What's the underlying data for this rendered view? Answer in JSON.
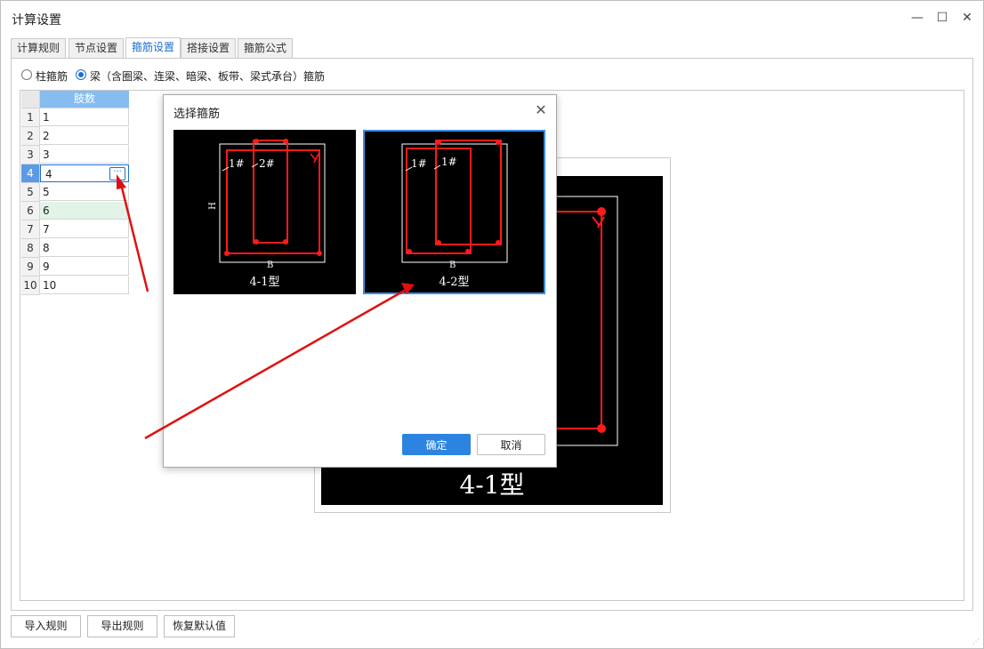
{
  "window": {
    "title": "计算设置"
  },
  "tabs": [
    {
      "label": "计算规则"
    },
    {
      "label": "节点设置"
    },
    {
      "label": "箍筋设置"
    },
    {
      "label": "搭接设置"
    },
    {
      "label": "箍筋公式"
    }
  ],
  "radio": {
    "option1": "柱箍筋",
    "option2": "梁（含圈梁、连梁、暗梁、板带、梁式承台）箍筋"
  },
  "grid": {
    "header": "肢数",
    "rows": [
      {
        "num": "1",
        "value": "1"
      },
      {
        "num": "2",
        "value": "2"
      },
      {
        "num": "3",
        "value": "3"
      },
      {
        "num": "4",
        "value": "4"
      },
      {
        "num": "5",
        "value": "5"
      },
      {
        "num": "6",
        "value": "6"
      },
      {
        "num": "7",
        "value": "7"
      },
      {
        "num": "8",
        "value": "8"
      },
      {
        "num": "9",
        "value": "9"
      },
      {
        "num": "10",
        "value": "10"
      }
    ]
  },
  "preview": {
    "caption": "4-1型"
  },
  "dialog": {
    "title": "选择箍筋",
    "thumb1": {
      "caption": "4-1型",
      "label1": "1#",
      "label2": "2#",
      "dim_h": "H",
      "dim_b": "B"
    },
    "thumb2": {
      "caption": "4-2型",
      "label1": "1#",
      "label2": "1#",
      "dim_b": "B"
    },
    "ok": "确定",
    "cancel": "取消"
  },
  "bottom": {
    "import": "导入规则",
    "export": "导出规则",
    "restore": "恢复默认值"
  },
  "colors": {
    "accent": "#1e6fd0",
    "rebar": "#ff1a1a",
    "annotation_arrow": "#e01010"
  }
}
